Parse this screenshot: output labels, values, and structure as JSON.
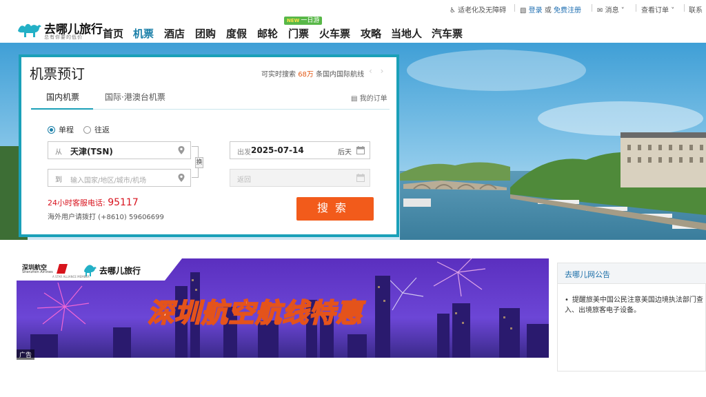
{
  "topbar": {
    "accessibility": "适老化及无障碍",
    "login": "登录",
    "or": "或",
    "register": "免费注册",
    "messages": "消息",
    "orders": "查看订单",
    "contact": "联系"
  },
  "logo": {
    "name": "去哪儿旅行",
    "slogan": "总有你要的低价"
  },
  "nav": {
    "items": [
      "首页",
      "机票",
      "酒店",
      "团购",
      "度假",
      "邮轮",
      "门票",
      "火车票",
      "攻略",
      "当地人",
      "汽车票"
    ],
    "active": "机票",
    "badge_new": "NEW",
    "badge_text": "一日游"
  },
  "booking": {
    "title": "机票预订",
    "realtime_prefix": "可实时搜索",
    "realtime_count": "68万",
    "realtime_suffix": "条国内国际航线",
    "tabs": [
      "国内机票",
      "国际·港澳台机票"
    ],
    "my_orders": "我的订单",
    "trip_types": [
      "单程",
      "往返"
    ],
    "selected_trip_type": "单程",
    "from_label": "从",
    "from_value": "天津(TSN)",
    "to_label": "到",
    "to_placeholder": "输入国家/地区/城市/机场",
    "depart_label": "出发",
    "depart_value": "2025-07-14",
    "depart_hint": "后天",
    "return_label": "返回",
    "swap_label": "换",
    "hotline_label": "24小时客服电话:",
    "hotline_number": "95117",
    "overseas": "海外用户请拨打 (+8610) 59606699",
    "search_button": "搜索"
  },
  "banner": {
    "airline": "深圳航空",
    "airline_en": "Shenzhen Airlines",
    "alliance": "A STAR ALLIANCE MEMBER",
    "partner": "去哪儿旅行",
    "headline": "深圳航空航线特惠",
    "ad_label": "广告"
  },
  "notice": {
    "title": "去哪儿网公告",
    "items": [
      "提醒旅美中国公民注意美国边境执法部门查入、出境旅客电子设备。"
    ]
  },
  "colors": {
    "accent": "#1aa0b8",
    "search_button": "#f25b1b",
    "hotline": "#d8141f",
    "link": "#1f6fb2"
  }
}
